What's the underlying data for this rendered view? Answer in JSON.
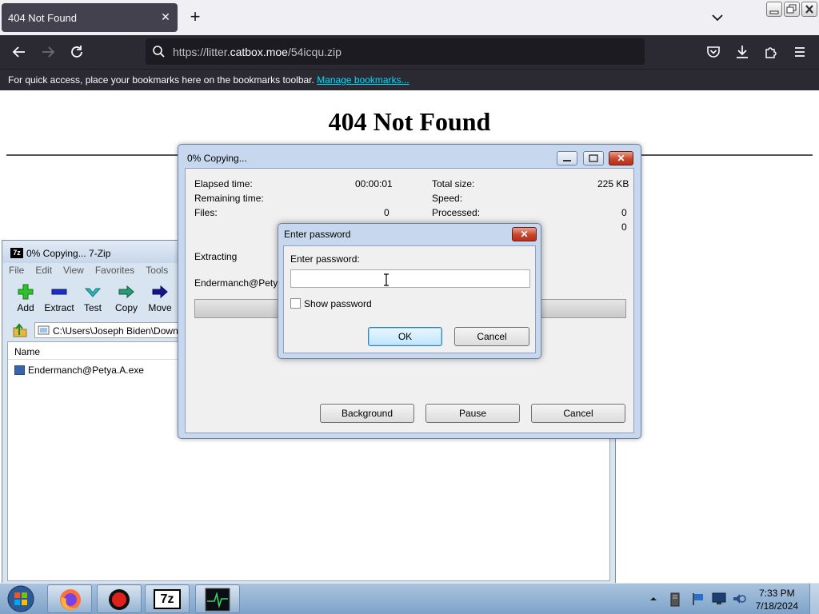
{
  "browser": {
    "tab": {
      "title": "404 Not Found",
      "close_glyph": "✕"
    },
    "new_tab_glyph": "+",
    "url": {
      "prefix": "https://litter.",
      "domain": "catbox.moe",
      "path": "/54icqu.zip"
    },
    "bookmarks_bar": {
      "text": "For quick access, place your bookmarks here on the bookmarks toolbar.",
      "link": "Manage bookmarks..."
    }
  },
  "page": {
    "heading": "404 Not Found"
  },
  "zip_window": {
    "title": "0% Copying... 7-Zip",
    "title_icon": "7z",
    "menu": [
      "File",
      "Edit",
      "View",
      "Favorites",
      "Tools"
    ],
    "toolbar": [
      "Add",
      "Extract",
      "Test",
      "Copy",
      "Move"
    ],
    "path": "C:\\Users\\Joseph Biden\\Downloads\\",
    "columns": [
      "Name"
    ],
    "files": [
      "Endermanch@Petya.A.exe"
    ]
  },
  "progress_dialog": {
    "title": "0% Copying...",
    "elapsed_label": "Elapsed time:",
    "elapsed_value": "00:00:01",
    "remaining_label": "Remaining time:",
    "files_label": "Files:",
    "files_value": "0",
    "total_size_label": "Total size:",
    "total_size_value": "225 KB",
    "speed_label": "Speed:",
    "processed_label": "Processed:",
    "processed_value": "0",
    "extra_value": "0",
    "status": "Extracting",
    "current_file": "Endermanch@Petya.A.exe",
    "buttons": {
      "background": "Background",
      "pause": "Pause",
      "cancel": "Cancel"
    }
  },
  "password_dialog": {
    "title": "Enter password",
    "close_glyph": "✕",
    "label": "Enter password:",
    "value": "",
    "show_password_label": "Show password",
    "show_password_checked": false,
    "ok": "OK",
    "cancel": "Cancel"
  },
  "taskbar": {
    "apps": [
      "Firefox",
      "Recorder",
      "7-Zip",
      "Task Manager"
    ],
    "time": "7:33 PM",
    "date": "7/18/2024",
    "seven_zip_badge": "7z"
  },
  "colors": {
    "browser_dark": "#2b2a33",
    "link": "#00ddff",
    "dialog_frame": "#c6d7ee",
    "close_red": "#c7452d"
  },
  "icons": [
    "back-icon",
    "forward-icon",
    "reload-icon",
    "search-icon",
    "pocket-icon",
    "downloads-icon",
    "extensions-icon",
    "menu-icon",
    "chevron-down-icon",
    "up-folder-icon",
    "file-icon",
    "start-orb-icon",
    "firefox-icon",
    "record-icon",
    "7zip-icon",
    "task-manager-icon"
  ]
}
